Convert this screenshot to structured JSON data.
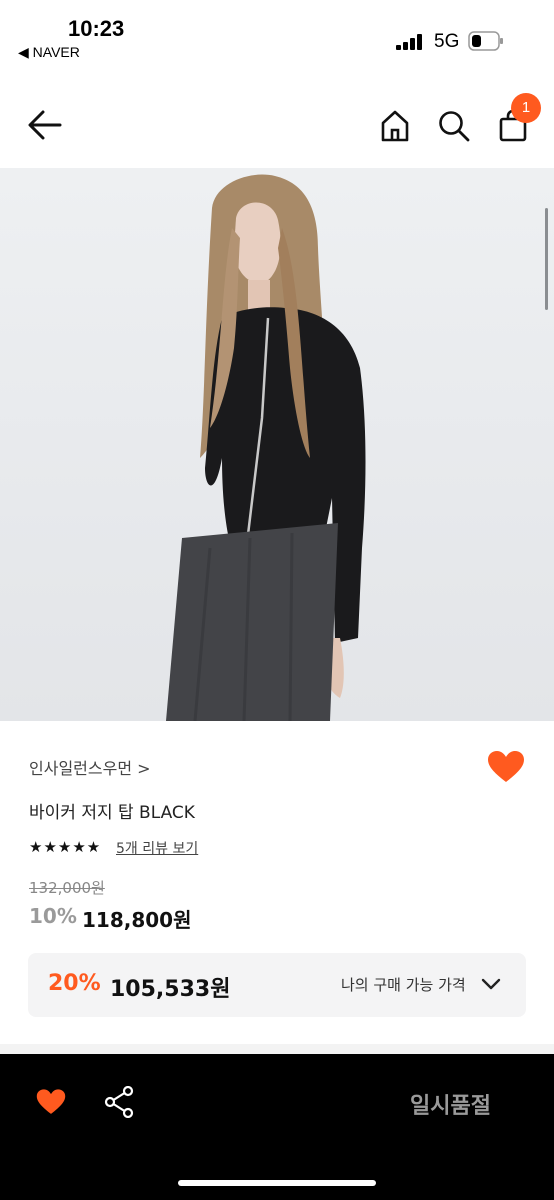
{
  "status_bar": {
    "time": "10:23",
    "back_app": "◀ NAVER",
    "network": "5G"
  },
  "header": {
    "cart_count": "1"
  },
  "product": {
    "brand": "인사일런스우먼 >",
    "title": "바이커 저지 탑 BLACK",
    "stars": "★★★★★",
    "reviews_label": "5개 리뷰 보기",
    "original_price": "132,000원",
    "discount_pct": "10%",
    "sale_price": "118,800원",
    "my_price": {
      "discount_pct": "20%",
      "price": "105,533원",
      "label": "나의 구매 가능 가격"
    }
  },
  "bottom_bar": {
    "status_label": "일시품절"
  },
  "colors": {
    "accent": "#ff5a1f",
    "bottom_bar": "#000000",
    "muted": "#9a9a9a"
  },
  "icons": [
    "back-arrow-icon",
    "home-icon",
    "search-icon",
    "cart-icon",
    "heart-icon",
    "share-icon",
    "chevron-down-icon",
    "signal-icon",
    "battery-icon"
  ]
}
